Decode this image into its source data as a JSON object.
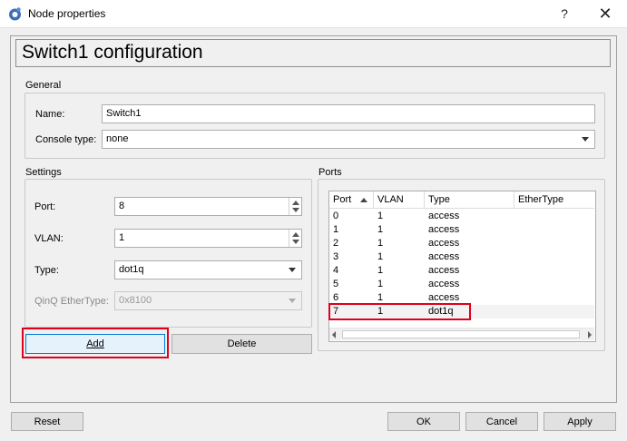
{
  "window": {
    "title": "Node properties",
    "help": "?",
    "close": "✕"
  },
  "header": {
    "title": "Switch1 configuration"
  },
  "general": {
    "label": "General",
    "name_label": "Name:",
    "name_value": "Switch1",
    "console_label": "Console type:",
    "console_value": "none"
  },
  "settings": {
    "label": "Settings",
    "port_label": "Port:",
    "port_value": "8",
    "vlan_label": "VLAN:",
    "vlan_value": "1",
    "type_label": "Type:",
    "type_value": "dot1q",
    "qinq_label": "QinQ EtherType:",
    "qinq_value": "0x8100"
  },
  "ports": {
    "label": "Ports",
    "columns": [
      "Port",
      "VLAN",
      "Type",
      "EtherType"
    ],
    "rows": [
      {
        "port": "0",
        "vlan": "1",
        "type": "access",
        "ethertype": ""
      },
      {
        "port": "1",
        "vlan": "1",
        "type": "access",
        "ethertype": ""
      },
      {
        "port": "2",
        "vlan": "1",
        "type": "access",
        "ethertype": ""
      },
      {
        "port": "3",
        "vlan": "1",
        "type": "access",
        "ethertype": ""
      },
      {
        "port": "4",
        "vlan": "1",
        "type": "access",
        "ethertype": ""
      },
      {
        "port": "5",
        "vlan": "1",
        "type": "access",
        "ethertype": ""
      },
      {
        "port": "6",
        "vlan": "1",
        "type": "access",
        "ethertype": ""
      },
      {
        "port": "7",
        "vlan": "1",
        "type": "dot1q",
        "ethertype": ""
      }
    ]
  },
  "actions": {
    "add": "Add",
    "delete": "Delete"
  },
  "footer": {
    "reset": "Reset",
    "ok": "OK",
    "cancel": "Cancel",
    "apply": "Apply"
  },
  "colors": {
    "highlight": "#e0001b",
    "accent": "#0078d7"
  }
}
